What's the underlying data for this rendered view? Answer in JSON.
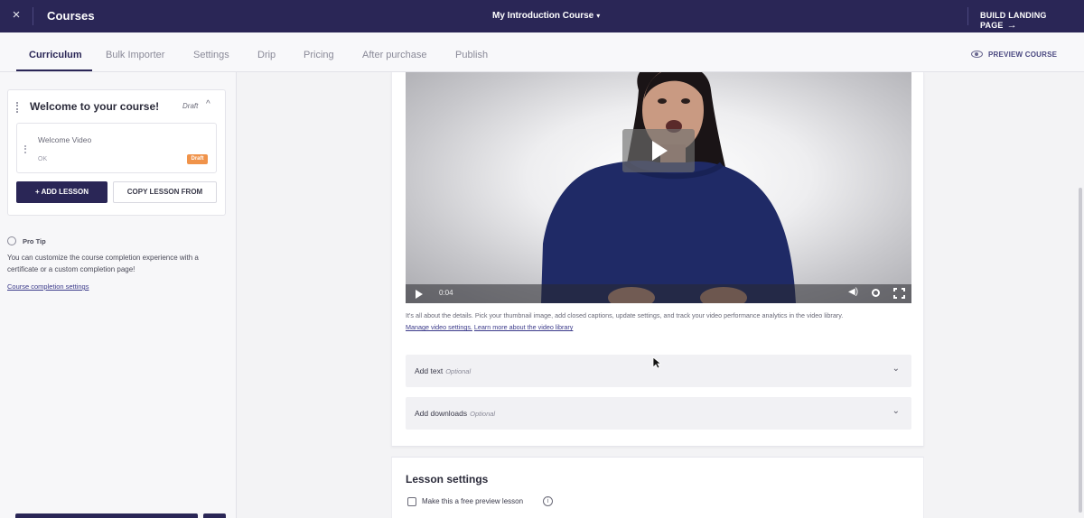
{
  "topbar": {
    "close_icon": "×",
    "title": "Courses",
    "course_name": "My Introduction Course",
    "course_caret": "▾",
    "build_label": "BUILD LANDING PAGE",
    "build_arrow": "→"
  },
  "tabs": [
    {
      "label": "Curriculum",
      "active": true
    },
    {
      "label": "Bulk Importer",
      "active": false
    },
    {
      "label": "Settings",
      "active": false
    },
    {
      "label": "Drip",
      "active": false
    },
    {
      "label": "Pricing",
      "active": false
    },
    {
      "label": "After purchase",
      "active": false
    },
    {
      "label": "Publish",
      "active": false
    }
  ],
  "preview_label": "PREVIEW COURSE",
  "sidebar": {
    "section_title": "Welcome to your course!",
    "section_status": "Draft",
    "section_caret": "^",
    "lesson": {
      "title": "Welcome Video",
      "type": "OK",
      "badge": "Draft"
    },
    "add_lesson": "+ ADD LESSON",
    "copy_lesson": "COPY LESSON FROM",
    "protip_label": "Pro Tip",
    "protip_text": "You can customize the course completion experience with a certificate or a custom completion page!",
    "protip_link": "Course completion settings"
  },
  "video": {
    "time": "0:04",
    "help_text": "It's all about the details. Pick your thumbnail image, add closed captions, update settings, and track your video performance analytics in the video library.",
    "link_manage": "Manage video settings.",
    "link_learn": "Learn more about the video library",
    "volume_icon": "◀)"
  },
  "accordions": [
    {
      "title": "Add text",
      "optional": "Optional",
      "caret": "⌄"
    },
    {
      "title": "Add downloads",
      "optional": "Optional",
      "caret": "⌄"
    }
  ],
  "lesson_settings": {
    "title": "Lesson settings",
    "checkbox_label": "Make this a free preview lesson",
    "info_icon": "i"
  },
  "colors": {
    "brand": "#2a2656",
    "draft_badge": "#f0934a",
    "link": "#3b3a8a"
  }
}
